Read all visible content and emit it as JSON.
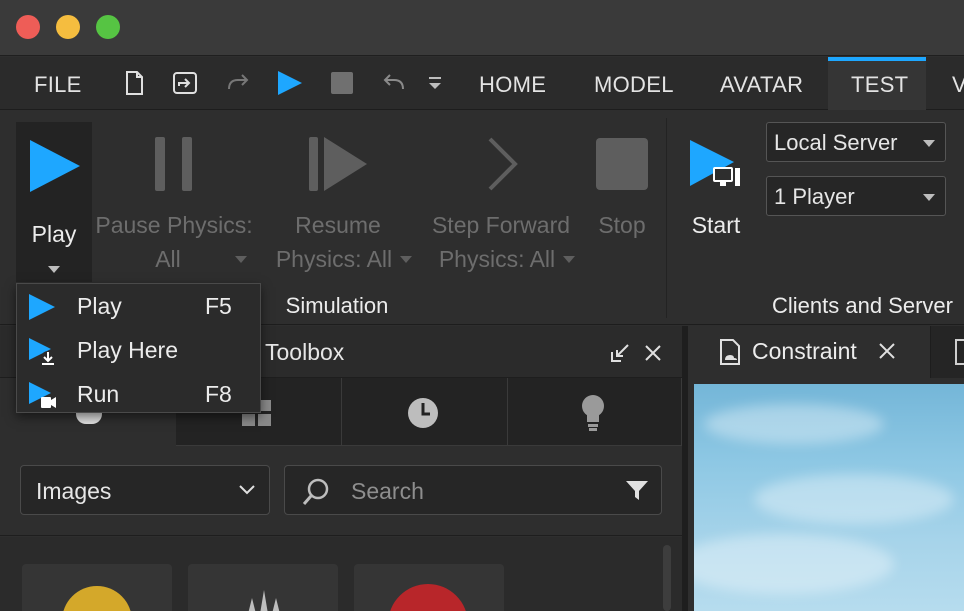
{
  "menubar": {
    "file": "FILE",
    "tabs": [
      "HOME",
      "MODEL",
      "AVATAR",
      "TEST",
      "V"
    ],
    "active_tab_index": 3
  },
  "ribbon": {
    "play_label": "Play",
    "pause_label_1": "Pause Physics:",
    "pause_label_2": "All",
    "resume_label_1": "Resume",
    "resume_label_2": "Physics: All",
    "step_label_1": "Step Forward",
    "step_label_2": "Physics: All",
    "stop_label": "Stop",
    "simulation_group": "Simulation",
    "start_label": "Start",
    "server_mode": "Local Server",
    "player_count": "1 Player",
    "clients_group": "Clients and Server"
  },
  "play_menu": {
    "items": [
      {
        "label": "Play",
        "key": "F5",
        "icon": "play-icon"
      },
      {
        "label": "Play Here",
        "key": "",
        "icon": "play-here-icon"
      },
      {
        "label": "Run",
        "key": "F8",
        "icon": "run-icon"
      }
    ]
  },
  "toolbox": {
    "title": "Toolbox",
    "category": "Images",
    "search_placeholder": "Search"
  },
  "document": {
    "tab_title": "Constraint"
  },
  "colors": {
    "accent": "#1ea7ff",
    "sky": "#8ec8e4"
  }
}
